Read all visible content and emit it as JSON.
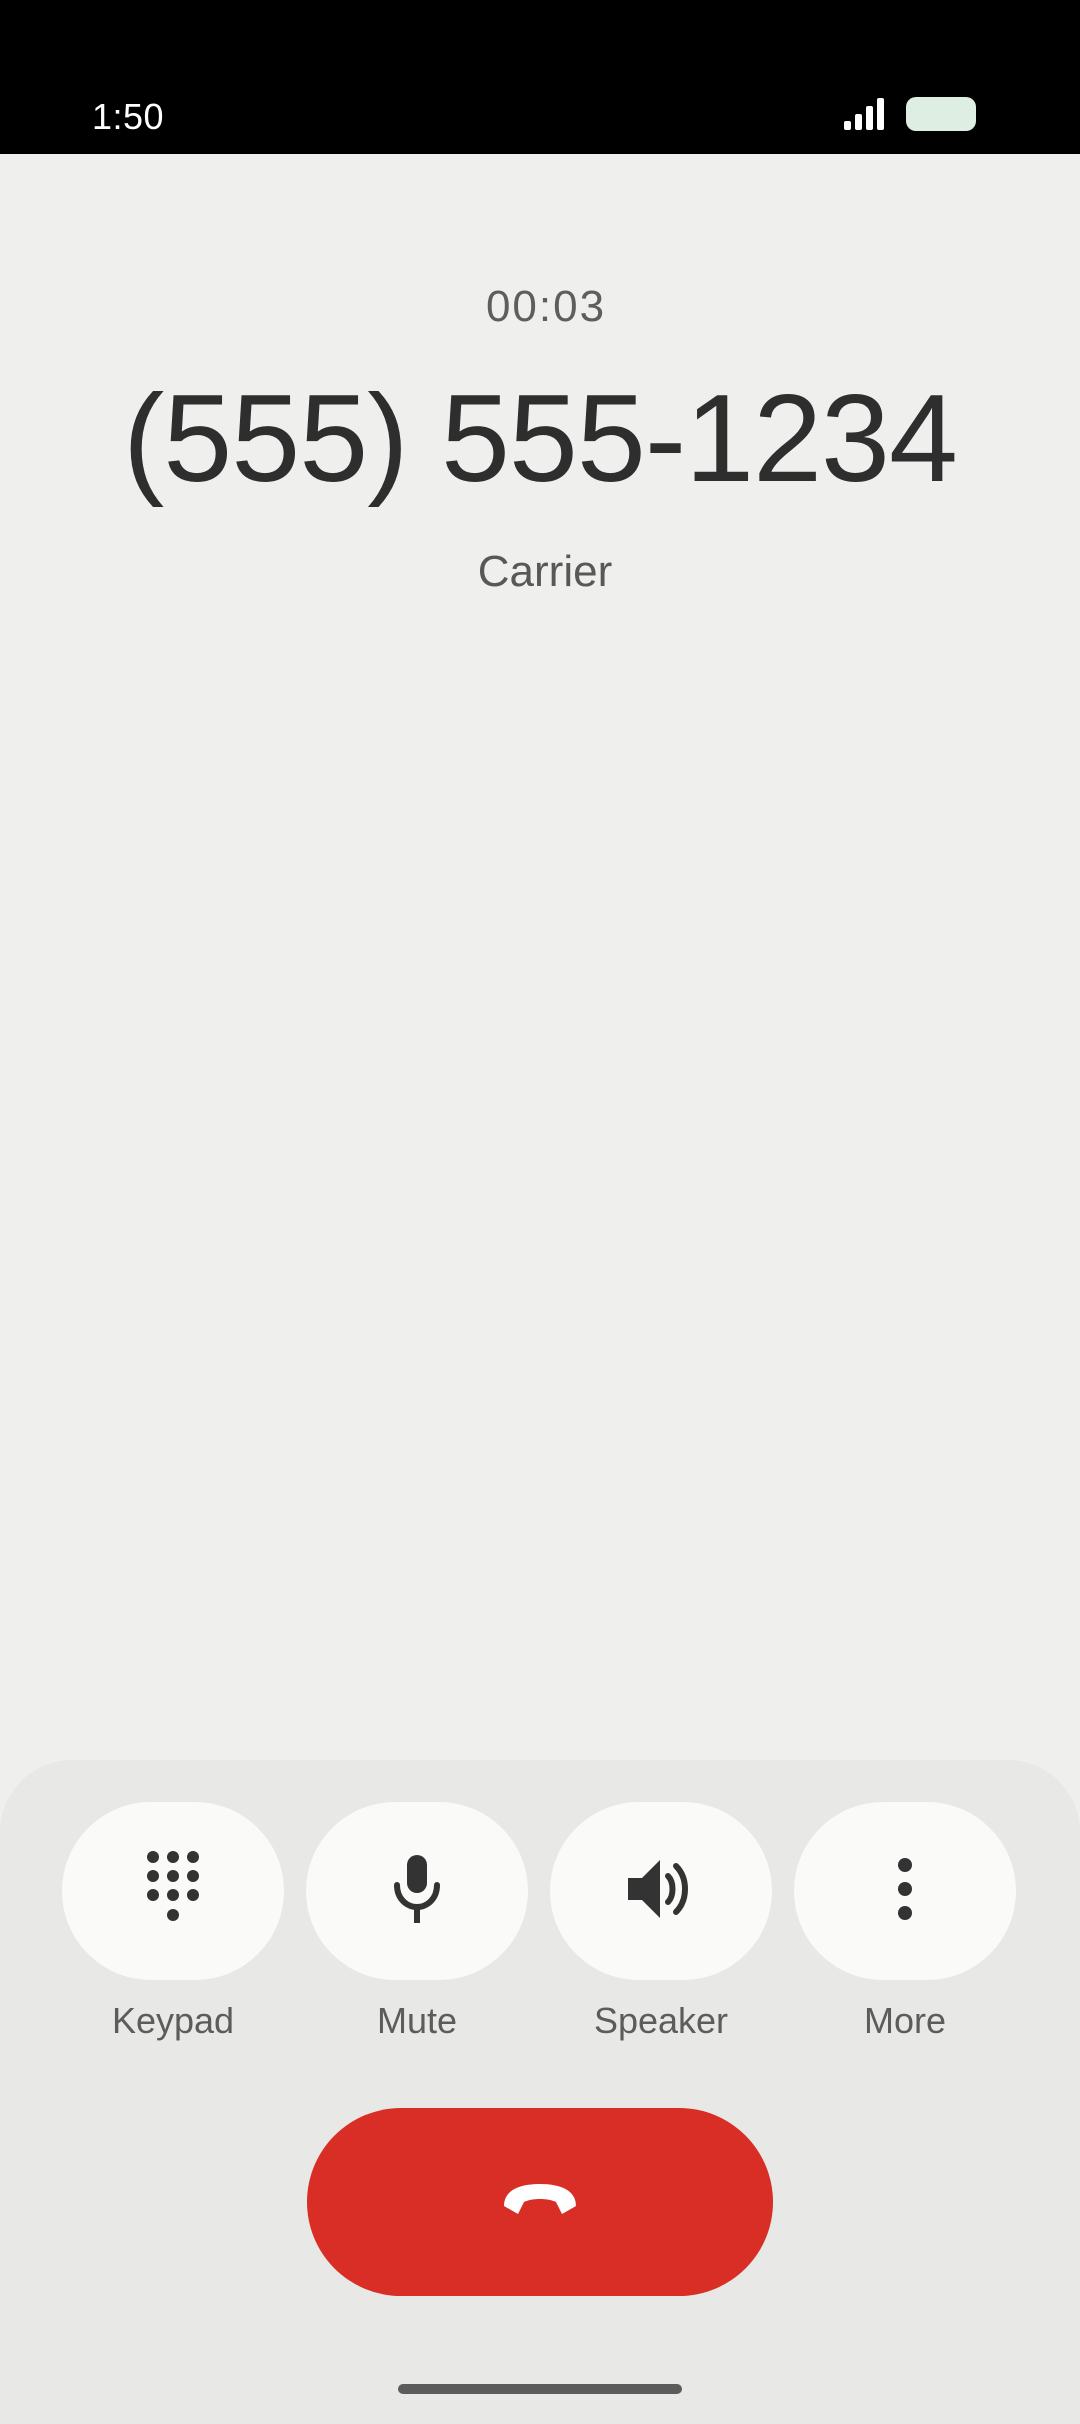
{
  "status_bar": {
    "time": "1:50",
    "signal_icon": "cellular-signal-icon",
    "battery_icon": "battery-icon"
  },
  "call": {
    "duration": "00:03",
    "number": "(555) 555-1234",
    "label": "Carrier"
  },
  "controls": {
    "keypad": {
      "label": "Keypad",
      "icon": "dialpad-icon"
    },
    "mute": {
      "label": "Mute",
      "icon": "microphone-icon"
    },
    "speaker": {
      "label": "Speaker",
      "icon": "speaker-volume-icon"
    },
    "more": {
      "label": "More",
      "icon": "more-vert-icon"
    }
  },
  "end_call": {
    "icon": "call-end-icon"
  },
  "colors": {
    "background": "#efefed",
    "panel": "#e8e8e6",
    "end_call": "#d82e25",
    "button": "#fafaf8"
  }
}
